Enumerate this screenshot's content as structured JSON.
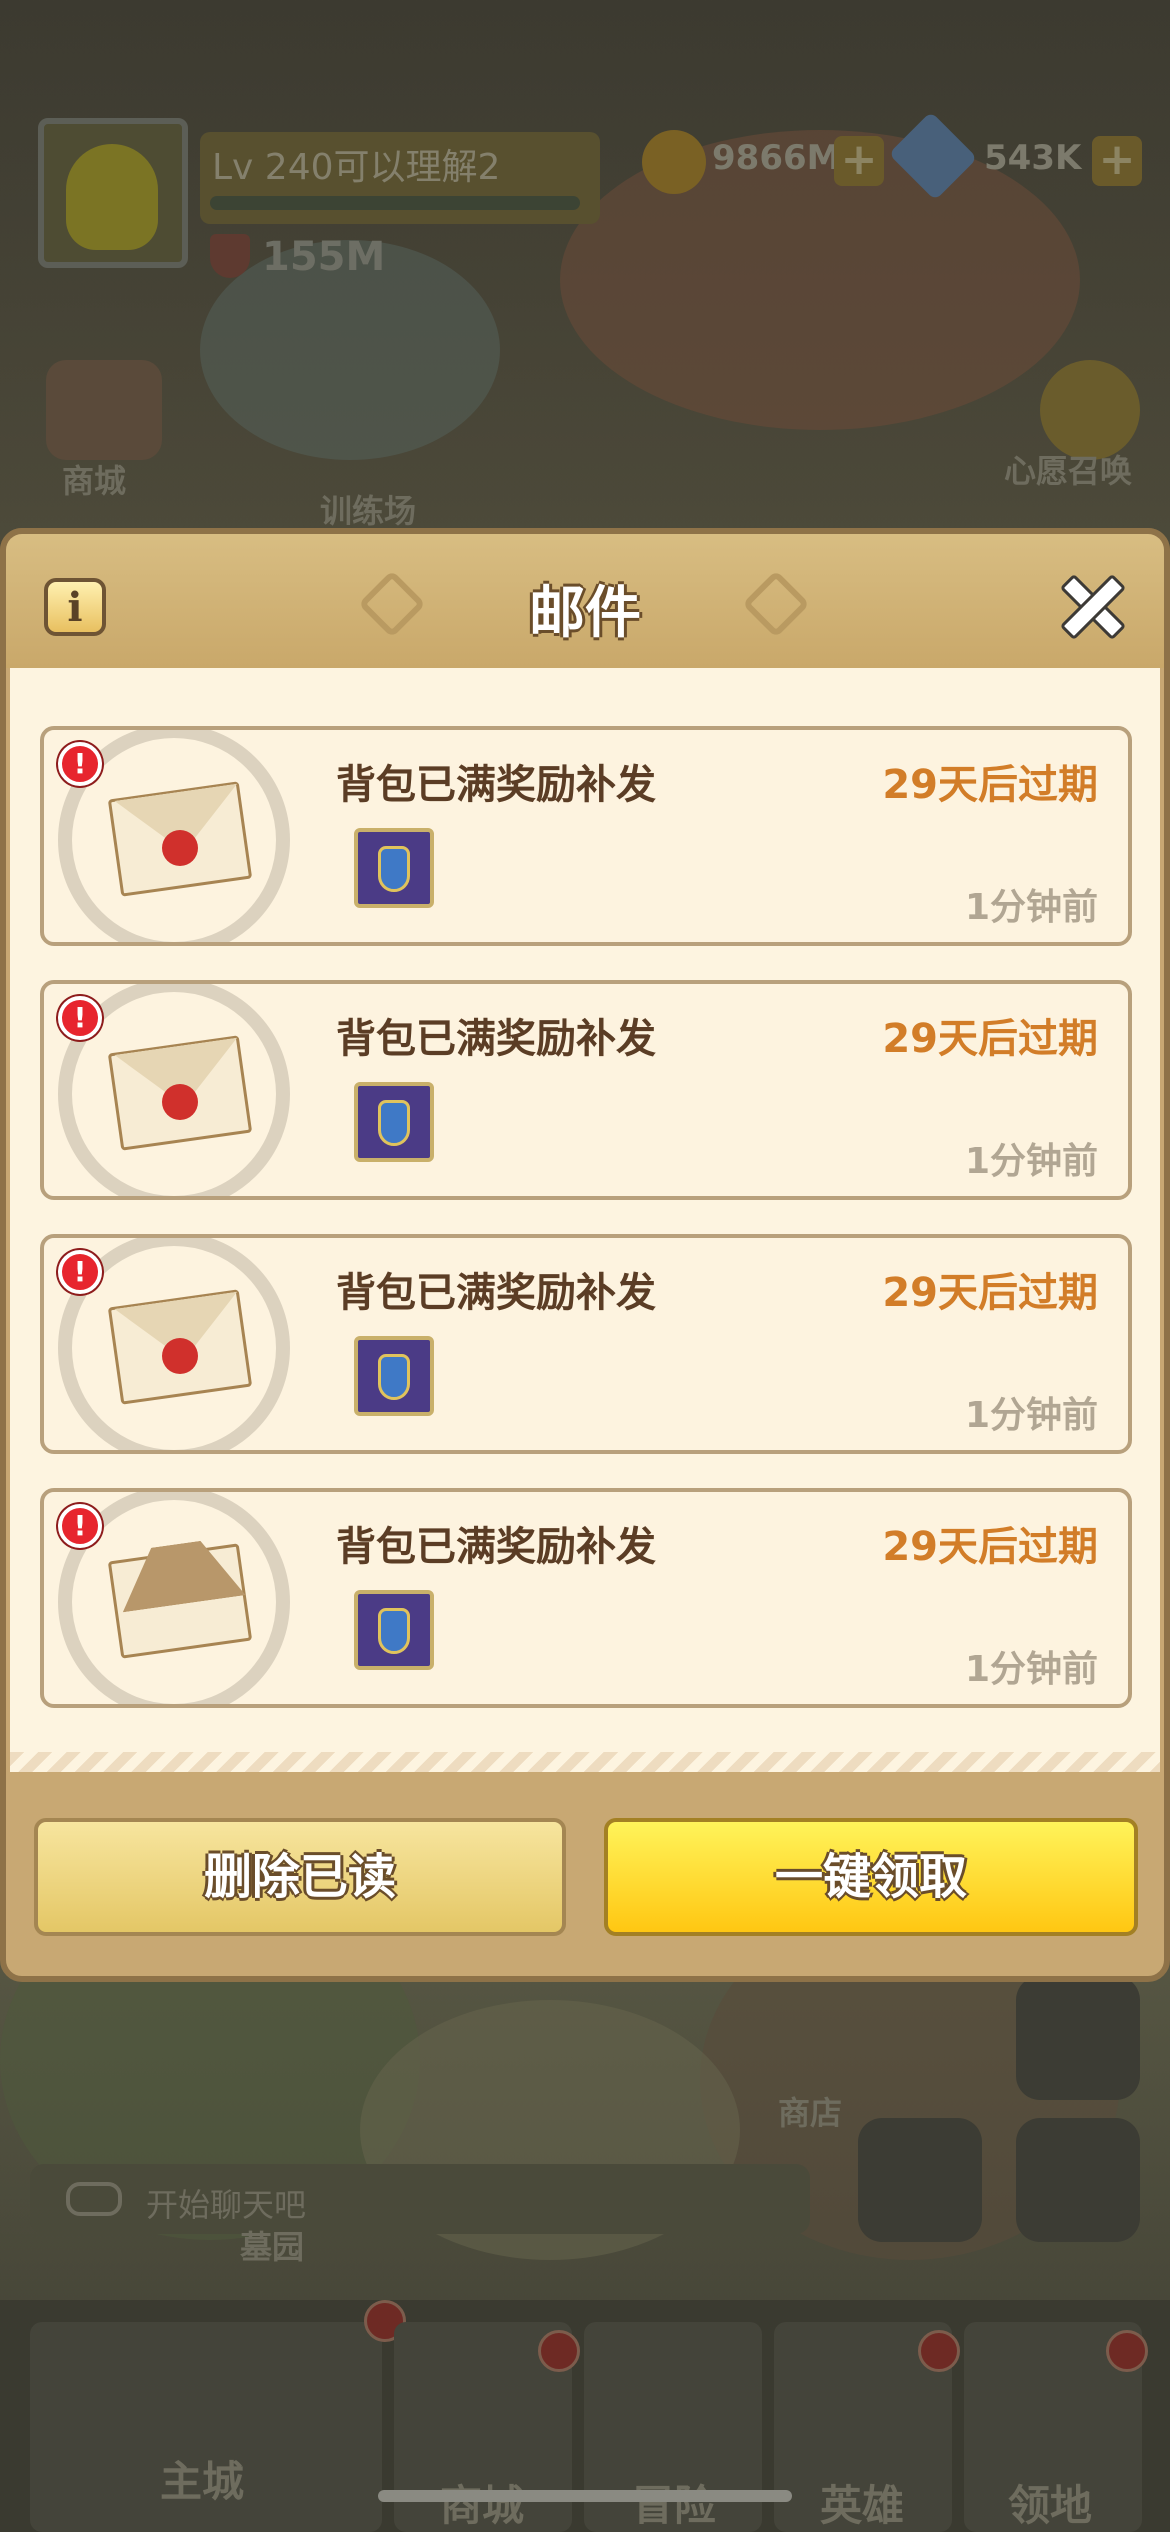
{
  "player": {
    "level_name": "Lv 240可以理解2",
    "power": "155M",
    "coins": "9866M",
    "gems": "543K"
  },
  "background_labels": {
    "shop": "商城",
    "training": "训练场",
    "wish": "心愿召唤",
    "store": "商店",
    "cemetery": "墓园",
    "chat_placeholder": "开始聊天吧"
  },
  "tabs": [
    {
      "label": "主城"
    },
    {
      "label": "商城"
    },
    {
      "label": "冒险"
    },
    {
      "label": "英雄"
    },
    {
      "label": "领地"
    }
  ],
  "dialog": {
    "title": "邮件",
    "info_icon": "i",
    "mails": [
      {
        "title": "背包已满奖励补发",
        "expire": "29天后过期",
        "time": "1分钟前",
        "status": "unread",
        "alert": "!"
      },
      {
        "title": "背包已满奖励补发",
        "expire": "29天后过期",
        "time": "1分钟前",
        "status": "unread",
        "alert": "!"
      },
      {
        "title": "背包已满奖励补发",
        "expire": "29天后过期",
        "time": "1分钟前",
        "status": "unread",
        "alert": "!"
      },
      {
        "title": "背包已满奖励补发",
        "expire": "29天后过期",
        "time": "1分钟前",
        "status": "read",
        "alert": "!"
      }
    ],
    "delete_read_label": "删除已读",
    "claim_all_label": "一键领取"
  },
  "colors": {
    "header": "#c9a86a",
    "expire_text": "#d27d28",
    "claim_button": "#ffc712",
    "alert": "#e7252e"
  }
}
